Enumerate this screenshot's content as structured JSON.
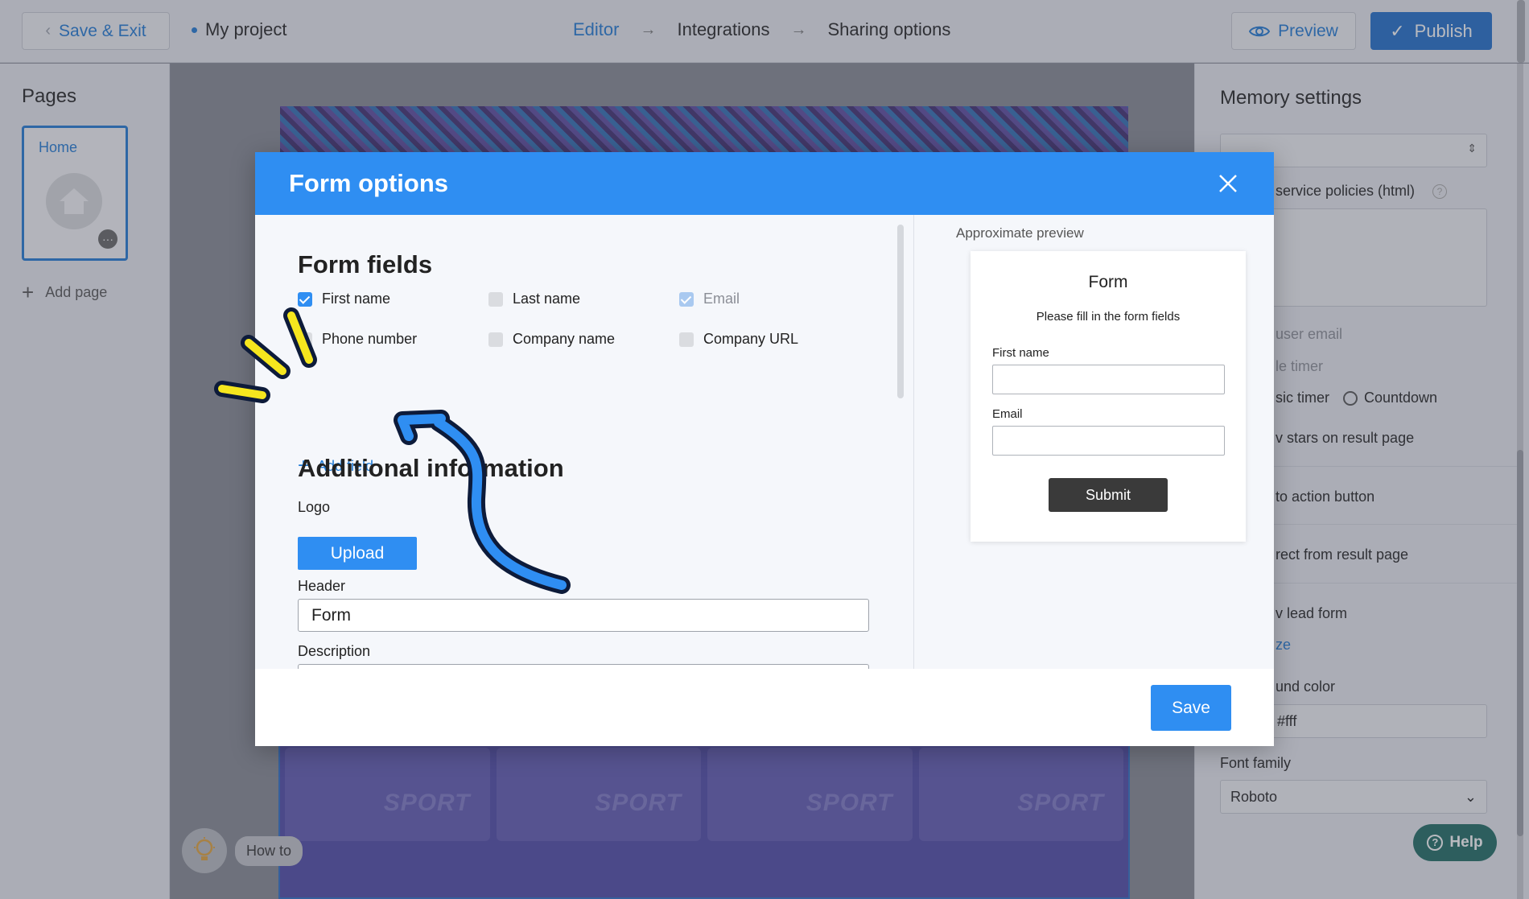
{
  "topbar": {
    "save_exit": "Save & Exit",
    "project": "My project",
    "steps": [
      "Editor",
      "Integrations",
      "Sharing options"
    ],
    "preview": "Preview",
    "publish": "Publish"
  },
  "left_panel": {
    "title": "Pages",
    "page_name": "Home",
    "add_page": "Add page"
  },
  "canvas": {
    "tile_text": "SPORT",
    "how_to": "How to"
  },
  "right_panel": {
    "title": "Memory settings",
    "privacy_label": "service policies (html)",
    "user_email": "user email",
    "timer_label": "le timer",
    "classic_timer": "sic timer",
    "countdown": "Countdown",
    "stars": "v stars on result page",
    "cta": "to action button",
    "redirect": "rect from result page",
    "lead_form": "v lead form",
    "customize": "ze",
    "bg_color_label": "und color",
    "bg_color_value": "#fff",
    "font_family_label": "Font family",
    "font_family_value": "Roboto",
    "help": "Help"
  },
  "modal": {
    "title": "Form options",
    "form_fields_title": "Form fields",
    "fields": [
      {
        "label": "First name",
        "checked": true
      },
      {
        "label": "Last name",
        "checked": false
      },
      {
        "label": "Email",
        "checked": true
      },
      {
        "label": "Phone number",
        "checked": false
      },
      {
        "label": "Company name",
        "checked": false
      },
      {
        "label": "Company URL",
        "checked": false
      }
    ],
    "add_field": "Add field",
    "additional_title": "Additional information",
    "logo_label": "Logo",
    "upload": "Upload",
    "header_label": "Header",
    "header_value": "Form",
    "description_label": "Description",
    "save": "Save"
  },
  "preview": {
    "label": "Approximate preview",
    "title": "Form",
    "subtitle": "Please fill in the form fields",
    "field1_label": "First name",
    "field2_label": "Email",
    "submit": "Submit"
  },
  "colors": {
    "primary": "#2f8ef2",
    "publish": "#1f6fcc",
    "annotation_arrow": "#2f8ef2",
    "annotation_marks": "#f5e61e",
    "help": "#1d6b63"
  }
}
